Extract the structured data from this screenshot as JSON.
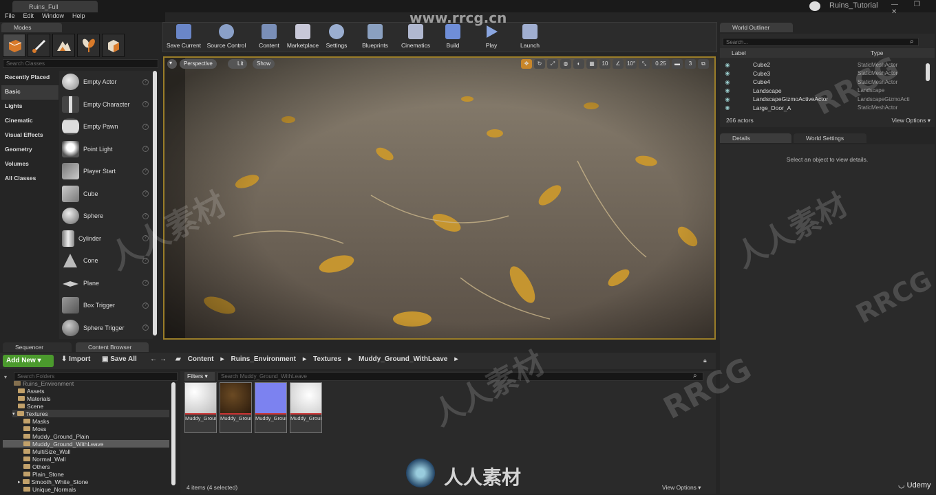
{
  "window": {
    "doc_tab": "Ruins_Full",
    "project_name": "Ruins_Tutorial",
    "controls": "— ❐ ✕"
  },
  "menu": [
    "File",
    "Edit",
    "Window",
    "Help"
  ],
  "modes": {
    "tab_label": "Modes",
    "search_placeholder": "Search Classes",
    "categories": [
      "Recently Placed",
      "Basic",
      "Lights",
      "Cinematic",
      "Visual Effects",
      "Geometry",
      "Volumes",
      "All Classes"
    ],
    "selected_category": "Basic",
    "items": [
      "Empty Actor",
      "Empty Character",
      "Empty Pawn",
      "Point Light",
      "Player Start",
      "Cube",
      "Sphere",
      "Cylinder",
      "Cone",
      "Plane",
      "Box Trigger",
      "Sphere Trigger"
    ]
  },
  "toolbar": {
    "buttons": [
      "Save Current",
      "Source Control",
      "Content",
      "Marketplace",
      "Settings",
      "Blueprints",
      "Cinematics",
      "Build",
      "Play",
      "Launch"
    ]
  },
  "viewport": {
    "perspective_label": "Perspective",
    "lit_label": "Lit",
    "show_label": "Show",
    "grid_snap": "10",
    "rot_snap": "10°",
    "scale_snap": "0.25",
    "camera_speed": "3"
  },
  "outliner": {
    "tab_label": "World Outliner",
    "search_placeholder": "Search...",
    "col_label": "Label",
    "col_type": "Type",
    "rows": [
      {
        "label": "Cube2",
        "type": "StaticMeshActor"
      },
      {
        "label": "Cube3",
        "type": "StaticMeshActor"
      },
      {
        "label": "Cube4",
        "type": "StaticMeshActor"
      },
      {
        "label": "Landscape",
        "type": "Landscape"
      },
      {
        "label": "LandscapeGizmoActiveActor",
        "type": "LandscapeGizmoActi"
      },
      {
        "label": "Large_Door_A",
        "type": "StaticMeshActor"
      }
    ],
    "actor_count": "266 actors",
    "view_options": "View Options ▾"
  },
  "details": {
    "tab_label": "Details",
    "world_settings_tab": "World Settings",
    "empty_message": "Select an object to view details."
  },
  "bottom_tabs": {
    "sequencer": "Sequencer",
    "content_browser": "Content Browser"
  },
  "content_browser": {
    "add_new": "Add New ▾",
    "import": "Import",
    "save_all": "Save All",
    "breadcrumbs": [
      "Content",
      "Ruins_Environment",
      "Textures",
      "Muddy_Ground_WithLeave"
    ],
    "folder_search_placeholder": "Search Folders",
    "filters_label": "Filters ▾",
    "asset_search_placeholder": "Search Muddy_Ground_WithLeave",
    "folders": [
      "Ruins_Environment",
      "Assets",
      "Materials",
      "Scene",
      "Textures",
      "Masks",
      "Moss",
      "Muddy_Ground_Plain",
      "Muddy_Ground_WithLeave",
      "MultiSize_Wall",
      "Normal_Wall",
      "Others",
      "Plain_Stone",
      "Smooth_White_Stone",
      "Unique_Normals"
    ],
    "selected_folder": "Muddy_Ground_WithLeave",
    "assets": [
      {
        "label": "Muddy_Ground_roughness",
        "color": "#e4e4e4"
      },
      {
        "label": "Muddy_Ground_basecolor",
        "color": "#3b2614"
      },
      {
        "label": "Muddy_Ground_normal",
        "color": "#7c82f0"
      },
      {
        "label": "Muddy_Ground_roughness",
        "color": "#e9e9e9"
      }
    ],
    "items_count": "4 items (4 selected)",
    "view_options": "View Options ▾"
  },
  "watermark": {
    "site": "www.rrcg.cn",
    "brand": "RRCG",
    "cn": "人人素材",
    "udemy": "Udemy"
  }
}
